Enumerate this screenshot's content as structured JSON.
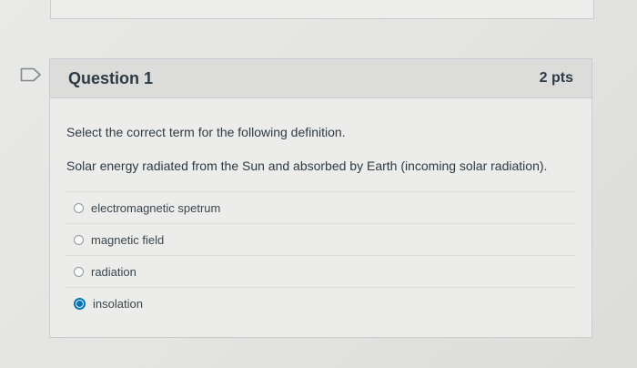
{
  "question": {
    "title": "Question 1",
    "points": "2 pts",
    "prompt": "Select the correct term for the following definition.",
    "definition": "Solar energy radiated from the Sun and absorbed by Earth (incoming solar radiation).",
    "answers": [
      {
        "label": "electromagnetic spetrum",
        "selected": false
      },
      {
        "label": "magnetic field",
        "selected": false
      },
      {
        "label": "radiation",
        "selected": false
      },
      {
        "label": "insolation",
        "selected": true
      }
    ]
  },
  "colors": {
    "accent": "#0374b5",
    "text": "#2d3b45",
    "header_bg": "#dcdcda"
  },
  "icons": {
    "flag": "flag-question-icon",
    "radio": "radio-button-icon"
  }
}
